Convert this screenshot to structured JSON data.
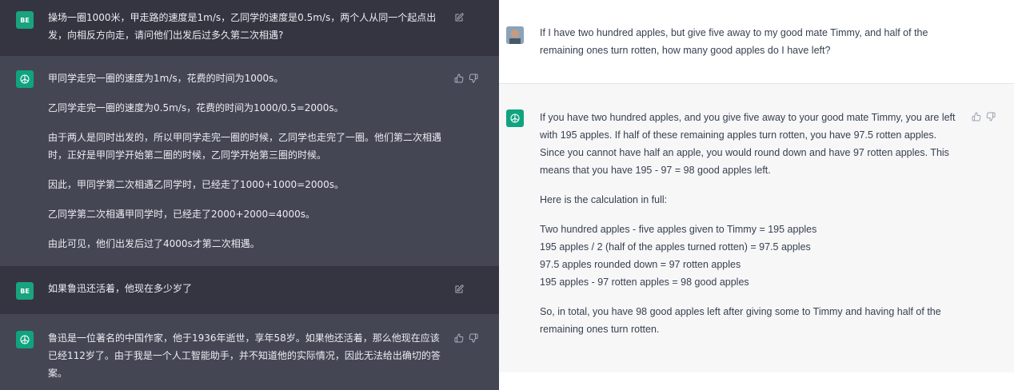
{
  "left": {
    "turns": [
      {
        "role": "user",
        "avatar": "BE",
        "text": "操场一圈1000米，甲走路的速度是1m/s，乙同学的速度是0.5m/s，两个人从同一个起点出发，向相反方向走，请问他们出发后过多久第二次相遇?"
      },
      {
        "role": "assistant",
        "paragraphs": [
          "甲同学走完一圈的速度为1m/s，花费的时间为1000s。",
          "乙同学走完一圈的速度为0.5m/s，花费的时间为1000/0.5=2000s。",
          "由于两人是同时出发的，所以甲同学走完一圈的时候，乙同学也走完了一圈。他们第二次相遇时，正好是甲同学开始第二圈的时候，乙同学开始第三圈的时候。",
          "因此，甲同学第二次相遇乙同学时，已经走了1000+1000=2000s。",
          "乙同学第二次相遇甲同学时，已经走了2000+2000=4000s。",
          "由此可见，他们出发后过了4000s才第二次相遇。"
        ]
      },
      {
        "role": "user",
        "avatar": "BE",
        "text": "如果鲁迅还活着，他现在多少岁了"
      },
      {
        "role": "assistant",
        "paragraphs": [
          "鲁迅是一位著名的中国作家，他于1936年逝世，享年58岁。如果他还活着，那么他现在应该已经112岁了。由于我是一个人工智能助手，并不知道他的实际情况，因此无法给出确切的答案。"
        ]
      }
    ]
  },
  "right": {
    "user_text": "If I have two hundred apples, but give five away to my good mate Timmy, and half of the remaining ones turn rotten, how many good apples do I have left?",
    "assistant_paragraphs": [
      "If you have two hundred apples, and you give five away to your good mate Timmy, you are left with 195 apples. If half of these remaining apples turn rotten, you have 97.5 rotten apples. Since you cannot have half an apple, you would round down and have 97 rotten apples. This means that you have 195 - 97 = 98 good apples left.",
      "Here is the calculation in full:"
    ],
    "calc_lines": [
      "Two hundred apples - five apples given to Timmy = 195 apples",
      "195 apples / 2 (half of the apples turned rotten) = 97.5 apples",
      "97.5 apples rounded down = 97 rotten apples",
      "195 apples - 97 rotten apples = 98 good apples"
    ],
    "summary": "So, in total, you have 98 good apples left after giving some to Timmy and having half of the remaining ones turn rotten."
  },
  "colors": {
    "left_user_bg": "#343541",
    "left_assistant_bg": "#444654",
    "right_user_bg": "#ffffff",
    "right_assistant_bg": "#f7f7f8",
    "accent": "#10a37f"
  },
  "icons": [
    "edit-icon",
    "thumbs-up-icon",
    "thumbs-down-icon",
    "openai-logo-icon"
  ]
}
